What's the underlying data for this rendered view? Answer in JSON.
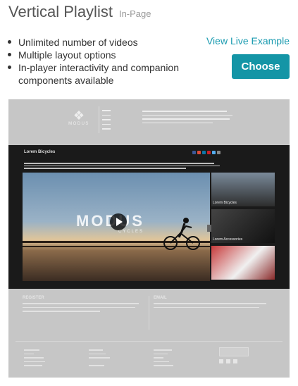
{
  "header": {
    "title": "Vertical Playlist",
    "subtitle": "In-Page"
  },
  "features": [
    "Unlimited number of videos",
    "Multiple layout options",
    "In-player interactivity and companion components available"
  ],
  "live_example_link": "View Live Example",
  "choose_button": "Choose",
  "preview": {
    "logo": "MODUS",
    "video": {
      "title": "Lorem Bicycles",
      "brand": "MODUS",
      "brand_sub": "CYCLES"
    },
    "playlist": [
      {
        "label": "Lorem Bicycles"
      },
      {
        "label": "Lorem Accessories"
      },
      {
        "label": ""
      }
    ],
    "footer": {
      "register_heading": "REGISTER",
      "email_heading": "EMAIL"
    }
  },
  "colors": {
    "accent": "#1495a6",
    "link": "#1a9bb0"
  }
}
